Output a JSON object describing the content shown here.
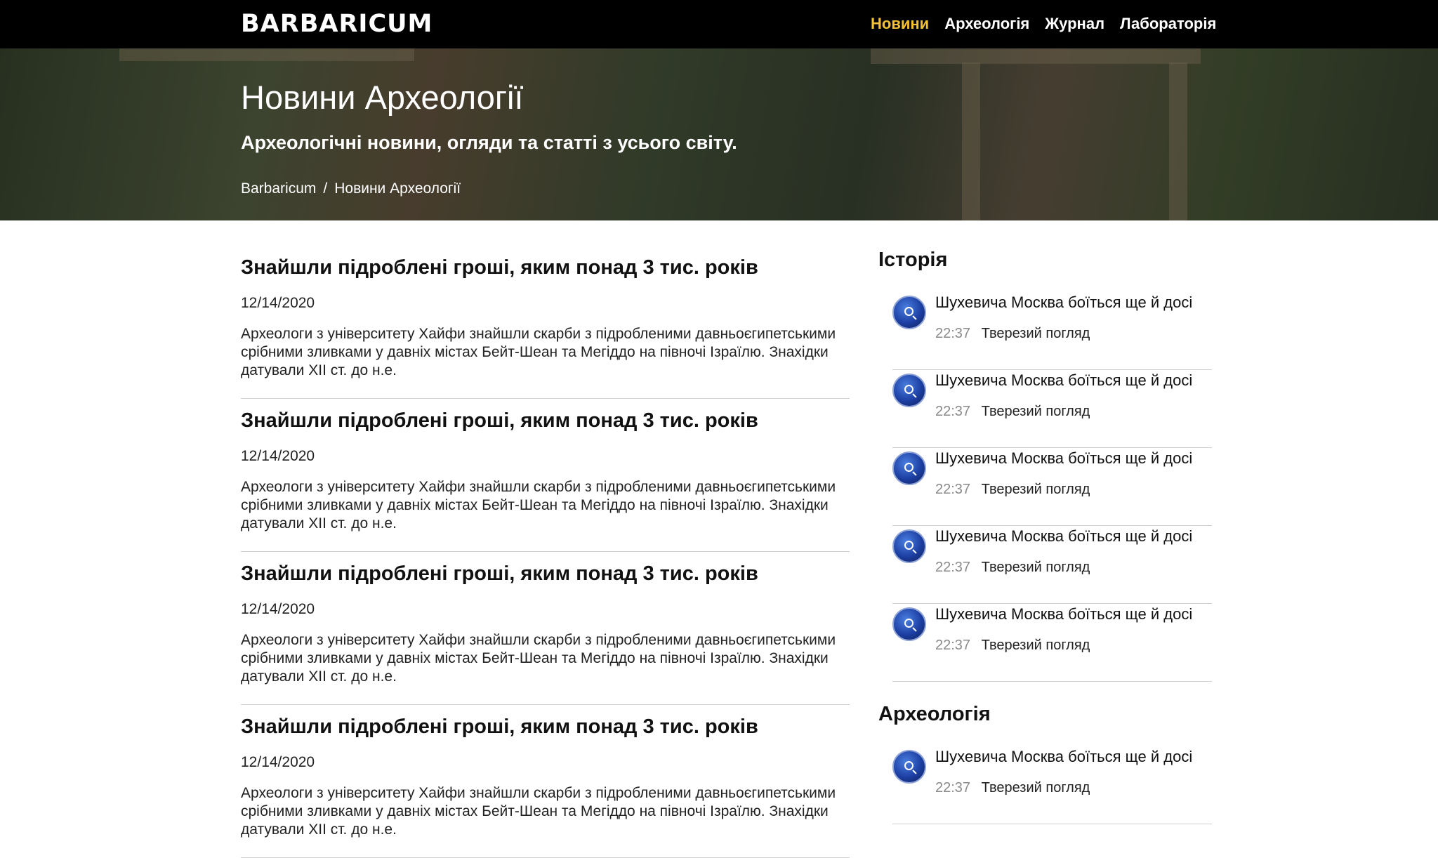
{
  "nav": {
    "logo": "BARBARICUM",
    "items": [
      {
        "label": "Новини",
        "active": true
      },
      {
        "label": "Археологія",
        "active": false
      },
      {
        "label": "Журнал",
        "active": false
      },
      {
        "label": "Лабораторія",
        "active": false
      }
    ],
    "active_color": "#f2c230"
  },
  "hero": {
    "title": "Новини Археології",
    "subtitle": "Археологічні новини, огляди та статті з усього світу.",
    "breadcrumb": [
      "Barbaricum",
      "Новини Археології"
    ],
    "breadcrumb_separator": "/"
  },
  "articles": [
    {
      "title": "Знайшли підроблені гроші, яким понад 3 тис. років",
      "date": "12/14/2020",
      "excerpt": "Археологи з університету Хайфи знайшли скарби з підробленими давньоєгипетськими срібними зливками у давніх містах Бейт-Шеан та Мегіддо на півночі Ізраїлю. Знахідки датували XII ст. до н.е."
    },
    {
      "title": "Знайшли підроблені гроші, яким понад 3 тис. років",
      "date": "12/14/2020",
      "excerpt": "Археологи з університету Хайфи знайшли скарби з підробленими давньоєгипетськими срібними зливками у давніх містах Бейт-Шеан та Мегіддо на півночі Ізраїлю. Знахідки датували XII ст. до н.е."
    },
    {
      "title": "Знайшли підроблені гроші, яким понад 3 тис. років",
      "date": "12/14/2020",
      "excerpt": "Археологи з університету Хайфи знайшли скарби з підробленими давньоєгипетськими срібними зливками у давніх містах Бейт-Шеан та Мегіддо на півночі Ізраїлю. Знахідки датували XII ст. до н.е."
    },
    {
      "title": "Знайшли підроблені гроші, яким понад 3 тис. років",
      "date": "12/14/2020",
      "excerpt": "Археологи з університету Хайфи знайшли скарби з підробленими давньоєгипетськими срібними зливками у давніх містах Бейт-Шеан та Мегіддо на півночі Ізраїлю. Знахідки датували XII ст. до н.е."
    }
  ],
  "sidebar": {
    "sections": [
      {
        "heading": "Історія",
        "items": [
          {
            "icon": "magnifier-icon",
            "title": "Шухевича Москва боїться ще й досі",
            "time": "22:37",
            "source": "Тверезий погляд"
          },
          {
            "icon": "magnifier-icon",
            "title": "Шухевича Москва боїться ще й досі",
            "time": "22:37",
            "source": "Тверезий погляд"
          },
          {
            "icon": "magnifier-icon",
            "title": "Шухевича Москва боїться ще й досі",
            "time": "22:37",
            "source": "Тверезий погляд"
          },
          {
            "icon": "magnifier-icon",
            "title": "Шухевича Москва боїться ще й досі",
            "time": "22:37",
            "source": "Тверезий погляд"
          },
          {
            "icon": "magnifier-icon",
            "title": "Шухевича Москва боїться ще й досі",
            "time": "22:37",
            "source": "Тверезий погляд"
          }
        ]
      },
      {
        "heading": "Археологія",
        "items": [
          {
            "icon": "magnifier-icon",
            "title": "Шухевича Москва боїться ще й досі",
            "time": "22:37",
            "source": "Тверезий погляд"
          }
        ]
      }
    ]
  }
}
